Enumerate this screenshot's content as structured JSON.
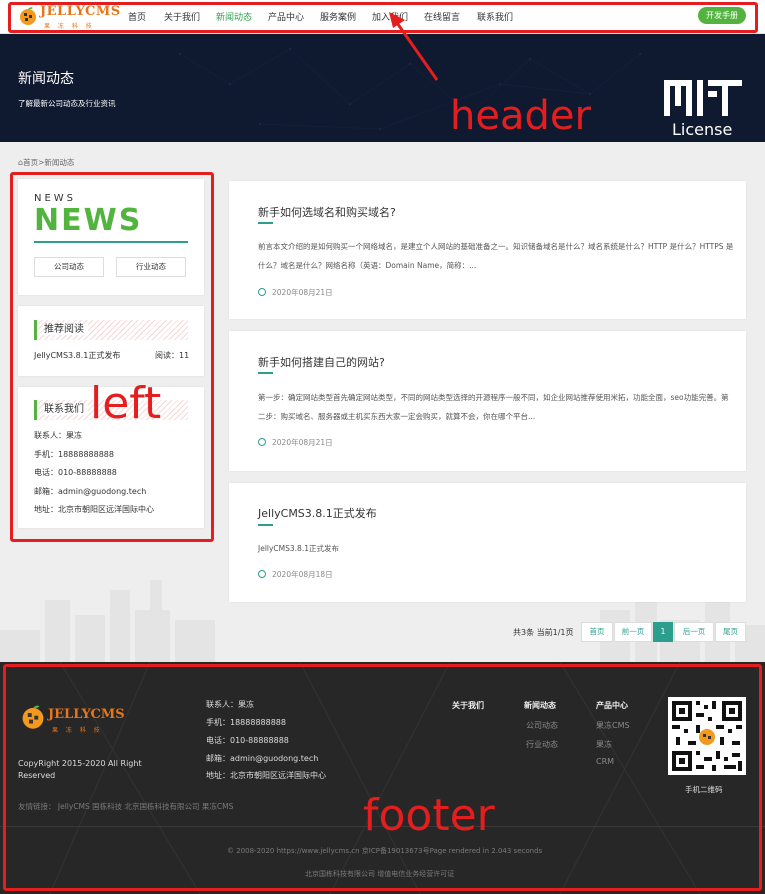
{
  "nav": {
    "logo_text": "JELLYCMS",
    "logo_sub": "果 冻 科 技",
    "items": [
      "首页",
      "关于我们",
      "新闻动态",
      "产品中心",
      "服务案例",
      "加入我们",
      "在线留言",
      "联系我们"
    ],
    "dev_button": "开发手册"
  },
  "banner": {
    "title": "新闻动态",
    "subtitle": "了解最新公司动态及行业资讯",
    "license_word": "License"
  },
  "annotations": {
    "header": "header",
    "left": "left",
    "footer": "footer"
  },
  "breadcrumb": {
    "home": "首页",
    "sep": ">",
    "current": "新闻动态"
  },
  "sidebar": {
    "news_small": "NEWS",
    "news_big": "NEWS",
    "buttons": [
      "公司动态",
      "行业动态"
    ],
    "recommend_title": "推荐阅读",
    "recommend_item": "JellyCMS3.8.1正式发布",
    "recommend_reads": "阅读：11",
    "contact_title": "联系我们",
    "contact": [
      "联系人：果冻",
      "手机：18888888888",
      "电话：010-88888888",
      "邮箱：admin@guodong.tech",
      "地址：北京市朝阳区远洋国际中心"
    ]
  },
  "articles": [
    {
      "title": "新手如何选域名和购买域名?",
      "desc": "前言本文介绍的是如何购买一个网络域名，是建立个人网站的基础准备之一。知识储备域名是什么？域名系统是什么？HTTP 是什么？HTTPS 是什么？域名是什么？网络名称（英语：Domain Name，简称：...",
      "date": "2020年08月21日"
    },
    {
      "title": "新手如何搭建自己的网站?",
      "desc": "第一步：确定网站类型首先确定网站类型，不同的网站类型选择的开源程序一般不同，如企业网站推荐使用米拓，功能全面，seo功能完善。第二步：购买域名、服务器或主机买东西大家一定会购买，就算不会，你在哪个平台...",
      "date": "2020年08月21日"
    },
    {
      "title": "JellyCMS3.8.1正式发布",
      "desc": "JellyCMS3.8.1正式发布",
      "date": "2020年08月18日"
    }
  ],
  "pager": {
    "info": "共3条 当前1/1页",
    "first": "首页",
    "prev": "前一页",
    "current": "1",
    "next": "后一页",
    "last": "尾页"
  },
  "footer": {
    "logo_text": "JELLYCMS",
    "logo_sub": "果 冻 科 技",
    "copyright_line1": "CopyRight 2015-2020 All Right",
    "copyright_line2": "Reserved",
    "contact": [
      "联系人：果冻",
      "手机：18888888888",
      "电话：010-88888888",
      "邮箱：admin@guodong.tech",
      "地址：北京市朝阳区远洋国际中心"
    ],
    "col_about": "关于我们",
    "col_news": "新闻动态",
    "news_links": [
      "公司动态",
      "行业动态"
    ],
    "col_products": "产品中心",
    "product_links": [
      "果冻CMS",
      "果冻",
      "CRM"
    ],
    "qr_label": "手机二维码",
    "friend_links": "友情链接： JellyCMS 国栋科技 北京国栋科技有限公司 果冻CMS",
    "bottom_line1": "© 2008-2020 https://www.jellycms.cn 京ICP备19013673号Page rendered in 2.043 seconds",
    "bottom_line2": "北京国栋科技有限公司 增值电信业务经营许可证"
  }
}
